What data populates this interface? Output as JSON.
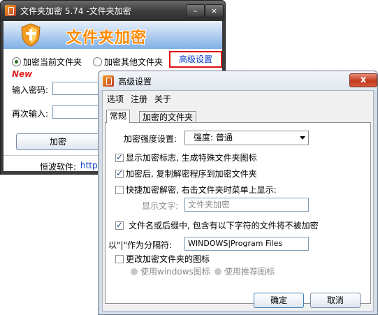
{
  "main_window": {
    "title": "文件夹加密 5.74 -文件夹加密",
    "min_symbol": "–",
    "close_symbol": "×",
    "banner_text": "文件夹加密",
    "radio_current": "加密当前文件夹",
    "radio_other": "加密其他文件夹",
    "advanced_link": "高级设置",
    "new_badge": "New",
    "password_label": "输入密码:",
    "confirm_label": "再次输入:",
    "encrypt_button": "加密",
    "footer_text": "恒波软件:",
    "footer_link": "http"
  },
  "advanced_window": {
    "title": "高级设置",
    "close_symbol": "x",
    "menu": [
      "选项",
      "注册",
      "关于"
    ],
    "tabs": [
      "常规",
      "加密的文件夹"
    ],
    "strength_label": "加密强度设置:",
    "strength_value": "强度: 普通",
    "chk_show_mark": "显示加密标志, 生成特殊文件夹图标",
    "chk_copy_decrypt": "加密后, 复制解密程序到加密文件夹",
    "chk_quick_decrypt": "快捷加密解密, 右击文件夹时菜单上显示:",
    "display_text_label": "显示文字:",
    "display_text_value": "文件夹加密",
    "chk_exclude": "文件名或后缀中, 包含有以下字符的文件将不被加密",
    "separator_label": "以\"|\"作为分隔符:",
    "separator_value": "WINDOWS|Program Files",
    "chk_change_icon": "更改加密文件夹的图标",
    "radio_windows_icon": "使用windows图标",
    "radio_recommended_icon": "使用推荐图标",
    "ok_button": "确定",
    "cancel_button": "取消",
    "checks": {
      "show_mark": true,
      "copy_decrypt": true,
      "quick_decrypt": false,
      "exclude": true,
      "change_icon": false
    }
  },
  "colors": {
    "highlight_border": "#e01010",
    "link": "#0b3cc8",
    "banner_text": "#ff8a00"
  }
}
